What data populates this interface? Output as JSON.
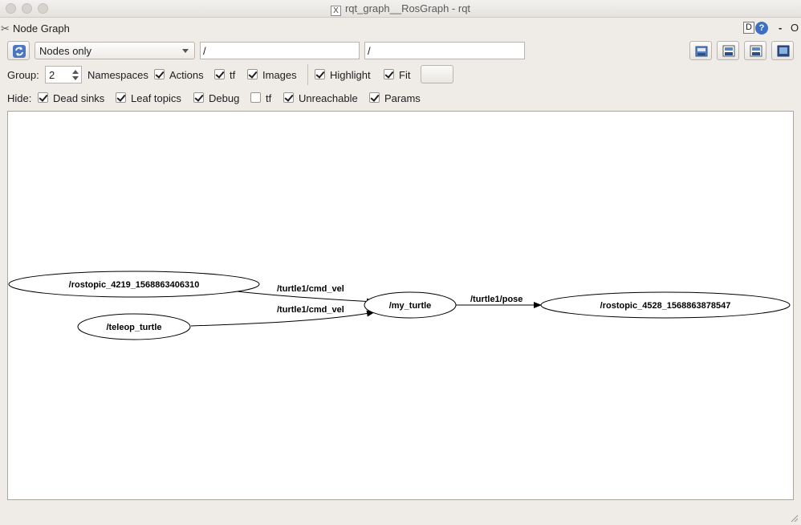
{
  "window": {
    "title": "rqt_graph__RosGraph - rqt"
  },
  "plugin": {
    "title": "Node Graph",
    "d_label": "D",
    "help_label": "?",
    "dash_label": "-",
    "o_label": "O"
  },
  "toolbar": {
    "graph_type": "Nodes only",
    "filter_include": "/",
    "filter_exclude": "/"
  },
  "options": {
    "group_label": "Group:",
    "group_value": "2",
    "namespaces": {
      "label": "Namespaces",
      "checked": true
    },
    "actions": {
      "label": "Actions",
      "checked": true
    },
    "tf": {
      "label": "tf",
      "checked": true
    },
    "images": {
      "label": "Images",
      "checked": true
    },
    "highlight": {
      "label": "Highlight",
      "checked": true
    },
    "fit": {
      "label": "Fit",
      "checked": true
    }
  },
  "hide": {
    "label": "Hide:",
    "dead_sinks": {
      "label": "Dead sinks",
      "checked": true
    },
    "leaf_topics": {
      "label": "Leaf topics",
      "checked": true
    },
    "debug": {
      "label": "Debug",
      "checked": true
    },
    "tf": {
      "label": "tf",
      "checked": false
    },
    "unreachable": {
      "label": "Unreachable",
      "checked": true
    },
    "params": {
      "label": "Params",
      "checked": true
    }
  },
  "graph": {
    "nodes": [
      {
        "id": "rostopic_4219",
        "label": "/rostopic_4219_1568863406310"
      },
      {
        "id": "teleop_turtle",
        "label": "/teleop_turtle"
      },
      {
        "id": "my_turtle",
        "label": "/my_turtle"
      },
      {
        "id": "rostopic_4528",
        "label": "/rostopic_4528_1568863878547"
      }
    ],
    "edges": [
      {
        "from": "rostopic_4219",
        "to": "my_turtle",
        "label": "/turtle1/cmd_vel"
      },
      {
        "from": "teleop_turtle",
        "to": "my_turtle",
        "label": "/turtle1/cmd_vel"
      },
      {
        "from": "my_turtle",
        "to": "rostopic_4528",
        "label": "/turtle1/pose"
      }
    ]
  }
}
